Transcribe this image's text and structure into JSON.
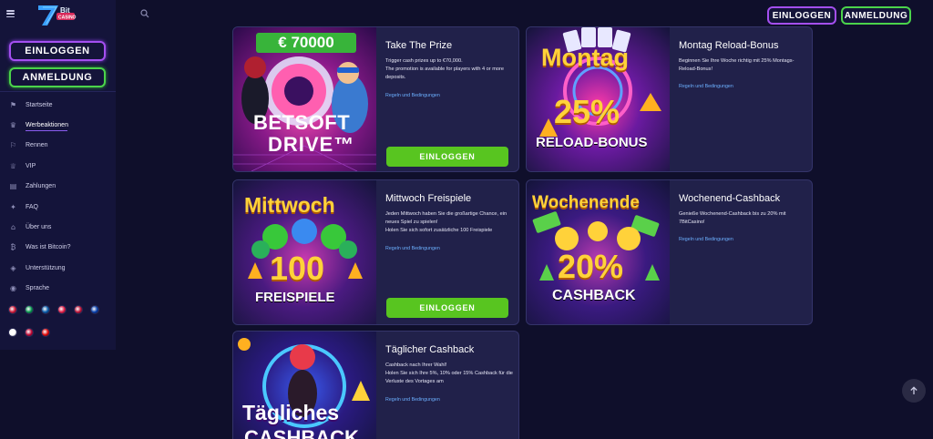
{
  "sidebar": {
    "login_label": "EINLOGGEN",
    "register_label": "ANMELDUNG",
    "nav": [
      {
        "label": "Startseite",
        "icon": "rocket-icon",
        "glyph": "⚑"
      },
      {
        "label": "Werbeaktionen",
        "icon": "promotions-icon",
        "glyph": "♛",
        "active": true
      },
      {
        "label": "Rennen",
        "icon": "race-flag-icon",
        "glyph": "⚐"
      },
      {
        "label": "VIP",
        "icon": "crown-icon",
        "glyph": "♕"
      },
      {
        "label": "Zahlungen",
        "icon": "wallet-icon",
        "glyph": "▤"
      },
      {
        "label": "FAQ",
        "icon": "question-icon",
        "glyph": "✦"
      },
      {
        "label": "Über uns",
        "icon": "home-icon",
        "glyph": "⌂"
      },
      {
        "label": "Was ist Bitcoin?",
        "icon": "bitcoin-icon",
        "glyph": "₿"
      },
      {
        "label": "Unterstützung",
        "icon": "support-icon",
        "glyph": "◈"
      },
      {
        "label": "Sprache",
        "icon": "globe-icon",
        "glyph": "◉"
      }
    ],
    "flags": [
      {
        "name": "flag-uk",
        "color": "#c8102e"
      },
      {
        "name": "flag-italy",
        "color": "#009246"
      },
      {
        "name": "flag-france",
        "color": "#0055a4"
      },
      {
        "name": "flag-poland",
        "color": "#dc143c"
      },
      {
        "name": "flag-norway",
        "color": "#ba0c2f"
      },
      {
        "name": "flag-russia",
        "color": "#0039a6"
      },
      {
        "name": "flag-finland",
        "color": "#ffffff"
      },
      {
        "name": "flag-japan",
        "color": "#bc002d"
      },
      {
        "name": "flag-germany",
        "color": "#dd0000"
      }
    ]
  },
  "header": {
    "login_label": "EINLOGGEN",
    "register_label": "ANMELDUNG"
  },
  "cards": [
    {
      "title": "Take The Prize",
      "desc": [
        "Trigger cash prizes up to €70,000.",
        "The promotion is available for players with 4 or more deposits."
      ],
      "terms": "Regeln und Bedingungen",
      "cta": "EINLOGGEN",
      "thumb_text": [
        "€ 70000",
        "BETSOFT",
        "DRIVE™"
      ]
    },
    {
      "title": "Montag Reload-Bonus",
      "desc": [
        "Beginnen Sie Ihre Woche richtig mit 25% Montags-Reload-Bonus!"
      ],
      "terms": "Regeln und Bedingungen",
      "thumb_text": [
        "Montag",
        "25%",
        "RELOAD-BONUS"
      ]
    },
    {
      "title": "Mittwoch Freispiele",
      "desc": [
        "Jeden Mittwoch haben Sie die großartige Chance, ein neues Spiel zu spielen!",
        "Holen Sie sich sofort zusätzliche 100 Freispiele"
      ],
      "terms": "Regeln und Bedingungen",
      "cta": "EINLOGGEN",
      "thumb_text": [
        "Mittwoch",
        "100",
        "FREISPIELE"
      ]
    },
    {
      "title": "Wochenend-Cashback",
      "desc": [
        "Genieße Wochenend-Cashback bis zu 20% mit 7BitCasino!"
      ],
      "terms": "Regeln und Bedingungen",
      "thumb_text": [
        "Wochenende",
        "20%",
        "CASHBACK"
      ]
    },
    {
      "title": "Täglicher Cashback",
      "desc": [
        "Cashback nach Ihrer Wahl!",
        "Holen Sie sich Ihre 5%, 10% oder 15% Cashback für die Verluste des Vortages am"
      ],
      "terms": "Regeln und Bedingungen",
      "thumb_text": [
        "Tägliches",
        "CASHBACK"
      ]
    }
  ]
}
